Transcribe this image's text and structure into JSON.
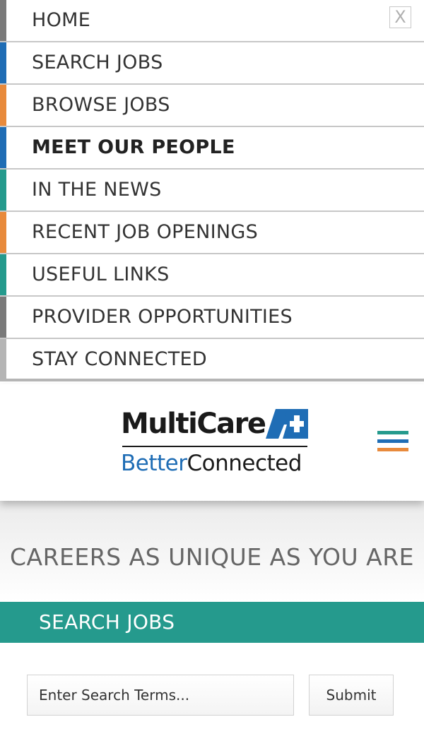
{
  "nav": {
    "close_label": "X",
    "items": [
      {
        "label": "HOME",
        "stripe_color": "#7a7a7a"
      },
      {
        "label": "SEARCH JOBS",
        "stripe_color": "#1f6db5"
      },
      {
        "label": "BROWSE JOBS",
        "stripe_color": "#e88a3c"
      },
      {
        "label": "MEET OUR PEOPLE",
        "stripe_color": "#1f6db5",
        "active": true
      },
      {
        "label": "IN THE NEWS",
        "stripe_color": "#259a8d"
      },
      {
        "label": "RECENT JOB OPENINGS",
        "stripe_color": "#e88a3c"
      },
      {
        "label": "USEFUL LINKS",
        "stripe_color": "#259a8d"
      },
      {
        "label": "PROVIDER OPPORTUNITIES",
        "stripe_color": "#7a7a7a"
      },
      {
        "label": "STAY CONNECTED",
        "stripe_color": "#b5b5b5"
      }
    ]
  },
  "header": {
    "logo": {
      "top_text": "MultiCare",
      "bottom_prefix": "Better",
      "bottom_suffix": "Connected",
      "brand_blue": "#1f6db5"
    },
    "menu_icon_colors": [
      "#259a8d",
      "#1f6db5",
      "#e88a3c"
    ]
  },
  "hero": {
    "tagline": "CAREERS AS UNIQUE AS YOU ARE"
  },
  "search": {
    "section_title": "SEARCH JOBS",
    "bar_color": "#259a8d",
    "input_placeholder": "Enter Search Terms...",
    "submit_label": "Submit"
  }
}
